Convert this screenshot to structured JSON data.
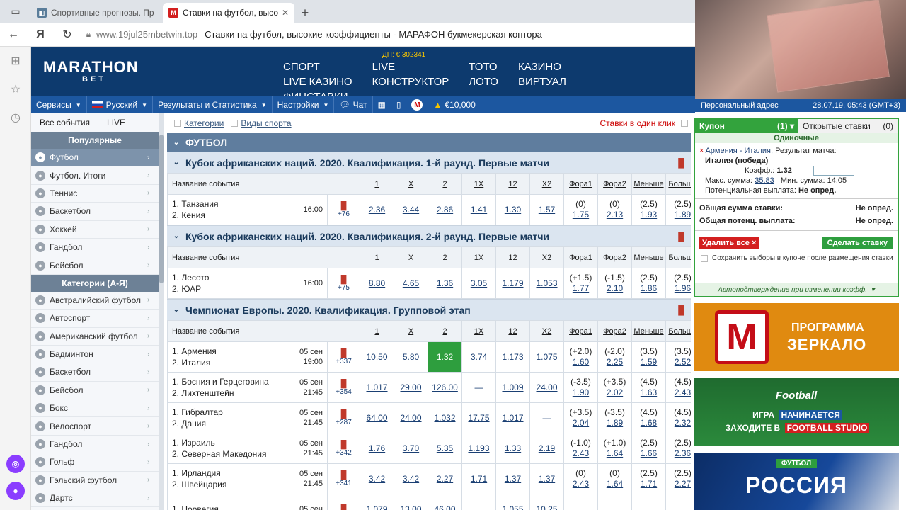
{
  "browser": {
    "tabs": [
      {
        "title": "Спортивные прогнозы. Пр",
        "active": false
      },
      {
        "title": "Ставки на футбол, высо",
        "active": true
      }
    ],
    "url": "www.19jul25mbetwin.top",
    "page_title": "Ставки на футбол, высокие коэффициенты - МАРАФОН букмекерская контора",
    "search_letter": "Я"
  },
  "header": {
    "logo_top": "MARATHON",
    "logo_bottom": "BET",
    "jackpot": "ДП: € 302341",
    "nav": [
      "СПОРТ",
      "LIVE",
      "ТОТО",
      "КАЗИНО",
      "LIVE КАЗИНО",
      "КОНСТРУКТОР",
      "ЛОТО",
      "ВИРТУАЛ",
      "ФИНСТАВКИ"
    ]
  },
  "toolbar": {
    "services": "Сервисы",
    "language": "Русский",
    "results": "Результаты и Статистика",
    "settings": "Настройки",
    "chat": "Чат",
    "balance": "€10,000"
  },
  "menu": {
    "all_events": "Все события",
    "live": "LIVE",
    "popular_head": "Популярные",
    "popular": [
      "Футбол",
      "Футбол. Итоги",
      "Теннис",
      "Баскетбол",
      "Хоккей",
      "Гандбол",
      "Бейсбол"
    ],
    "cats_head": "Категории (А-Я)",
    "cats": [
      "Австралийский футбол",
      "Автоспорт",
      "Американский футбол",
      "Бадминтон",
      "Баскетбол",
      "Бейсбол",
      "Бокс",
      "Велоспорт",
      "Гандбол",
      "Гольф",
      "Гэльский футбол",
      "Дартс"
    ]
  },
  "center": {
    "crumb_categories": "Категории",
    "crumb_sports": "Виды спорта",
    "one_click": "Ставки в один клик",
    "sport_title": "ФУТБОЛ",
    "columns": [
      "Название события",
      "1",
      "X",
      "2",
      "1X",
      "12",
      "X2",
      "Фора1",
      "Фора2",
      "Меньше",
      "Больше"
    ],
    "leagues": [
      {
        "title": "Кубок африканских наций. 2020. Квалификация. 1-й раунд. Первые матчи",
        "events": [
          {
            "t1": "1. Танзания",
            "t2": "2. Кения",
            "date": "",
            "time": "16:00",
            "more": "+76",
            "o1": "2.36",
            "ox": "3.44",
            "o2": "2.86",
            "o1x": "1.41",
            "o12": "1.30",
            "ox2": "1.57",
            "f1h": "(0)",
            "f1v": "1.75",
            "f2h": "(0)",
            "f2v": "2.13",
            "uh": "(2.5)",
            "uv": "1.93",
            "oh": "(2.5)",
            "ov": "1.89"
          }
        ]
      },
      {
        "title": "Кубок африканских наций. 2020. Квалификация. 2-й раунд. Первые матчи",
        "events": [
          {
            "t1": "1. Лесото",
            "t2": "2. ЮАР",
            "date": "",
            "time": "16:00",
            "more": "+75",
            "o1": "8.80",
            "ox": "4.65",
            "o2": "1.36",
            "o1x": "3.05",
            "o12": "1.179",
            "ox2": "1.053",
            "f1h": "(+1.5)",
            "f1v": "1.77",
            "f2h": "(-1.5)",
            "f2v": "2.10",
            "uh": "(2.5)",
            "uv": "1.86",
            "oh": "(2.5)",
            "ov": "1.96"
          }
        ]
      },
      {
        "title": "Чемпионат Европы. 2020. Квалификация. Групповой этап",
        "events": [
          {
            "t1": "1. Армения",
            "t2": "2. Италия",
            "date": "05 сен",
            "time": "19:00",
            "more": "+337",
            "o1": "10.50",
            "ox": "5.80",
            "o2": "1.32",
            "o1x": "3.74",
            "o12": "1.173",
            "ox2": "1.075",
            "f1h": "(+2.0)",
            "f1v": "1.60",
            "f2h": "(-2.0)",
            "f2v": "2.25",
            "uh": "(3.5)",
            "uv": "1.59",
            "oh": "(3.5)",
            "ov": "2.52"
          },
          {
            "t1": "1. Босния и Герцеговина",
            "t2": "2. Лихтенштейн",
            "date": "05 сен",
            "time": "21:45",
            "more": "+354",
            "o1": "1.017",
            "ox": "29.00",
            "o2": "126.00",
            "o1x": "—",
            "o12": "1.009",
            "ox2": "24.00",
            "f1h": "(-3.5)",
            "f1v": "1.90",
            "f2h": "(+3.5)",
            "f2v": "2.02",
            "uh": "(4.5)",
            "uv": "1.63",
            "oh": "(4.5)",
            "ov": "2.43"
          },
          {
            "t1": "1. Гибралтар",
            "t2": "2. Дания",
            "date": "05 сен",
            "time": "21:45",
            "more": "+287",
            "o1": "64.00",
            "ox": "24.00",
            "o2": "1.032",
            "o1x": "17.75",
            "o12": "1.017",
            "ox2": "—",
            "f1h": "(+3.5)",
            "f1v": "2.04",
            "f2h": "(-3.5)",
            "f2v": "1.89",
            "uh": "(4.5)",
            "uv": "1.68",
            "oh": "(4.5)",
            "ov": "2.32"
          },
          {
            "t1": "1. Израиль",
            "t2": "2. Северная Македония",
            "date": "05 сен",
            "time": "21:45",
            "more": "+342",
            "o1": "1.76",
            "ox": "3.70",
            "o2": "5.35",
            "o1x": "1.193",
            "o12": "1.33",
            "ox2": "2.19",
            "f1h": "(-1.0)",
            "f1v": "2.43",
            "f2h": "(+1.0)",
            "f2v": "1.64",
            "uh": "(2.5)",
            "uv": "1.66",
            "oh": "(2.5)",
            "ov": "2.36"
          },
          {
            "t1": "1. Ирландия",
            "t2": "2. Швейцария",
            "date": "05 сен",
            "time": "21:45",
            "more": "+341",
            "o1": "3.42",
            "ox": "3.42",
            "o2": "2.27",
            "o1x": "1.71",
            "o12": "1.37",
            "ox2": "1.37",
            "f1h": "(0)",
            "f1v": "2.43",
            "f2h": "(0)",
            "f2v": "1.64",
            "uh": "(2.5)",
            "uv": "1.71",
            "oh": "(2.5)",
            "ov": "2.27"
          },
          {
            "t1": "1. Норвегия",
            "t2": "",
            "date": "05 сен",
            "time": "",
            "more": "",
            "o1": "1.079",
            "ox": "13.00",
            "o2": "46.00",
            "o1x": "",
            "o12": "1.055",
            "ox2": "10.25",
            "f1h": "",
            "f1v": "",
            "f2h": "",
            "f2v": "",
            "uh": "",
            "uv": "",
            "oh": "",
            "ov": ""
          }
        ]
      }
    ]
  },
  "video_bar": {
    "left": "Персональный адрес",
    "right": "28.07.19, 05:43 (GMT+3)"
  },
  "coupon": {
    "tab_coupon": "Купон",
    "tab_coupon_count": "(1)",
    "tab_open": "Открытые ставки",
    "tab_open_count": "(0)",
    "singles": "Одиночные",
    "match": "Армения - Италия,",
    "market": "Результат матча:",
    "selection": "Италия (победа)",
    "coef_label": "Коэфф.:",
    "coef": "1.32",
    "max_label": "Макс. сумма:",
    "max": "35.83",
    "min_label": "Мин. сумма:",
    "min": "14.05",
    "payout_label": "Потенциальная выплата:",
    "payout": "Не опред.",
    "total_label": "Общая сумма ставки:",
    "total": "Не опред.",
    "total_payout_label": "Общая потенц. выплата:",
    "total_payout": "Не опред.",
    "delete_all": "Удалить все",
    "place_bet": "Сделать ставку",
    "save_choice": "Сохранить выборы в купоне после размещения ставки",
    "auto_confirm": "Автоподтверждение при изменении коэфф."
  },
  "ads": {
    "mirror_1": "ПРОГРАММА",
    "mirror_2": "ЗЕРКАЛО",
    "fs_logo": "Football",
    "fs_line1a": "ИГРА",
    "fs_line1b": "НАЧИНАЕТСЯ",
    "fs_line2a": "ЗАХОДИТЕ В",
    "fs_line2b": "FOOTBALL STUDIO",
    "ru_tag": "ФУТБОЛ",
    "ru_title": "РОССИЯ"
  }
}
